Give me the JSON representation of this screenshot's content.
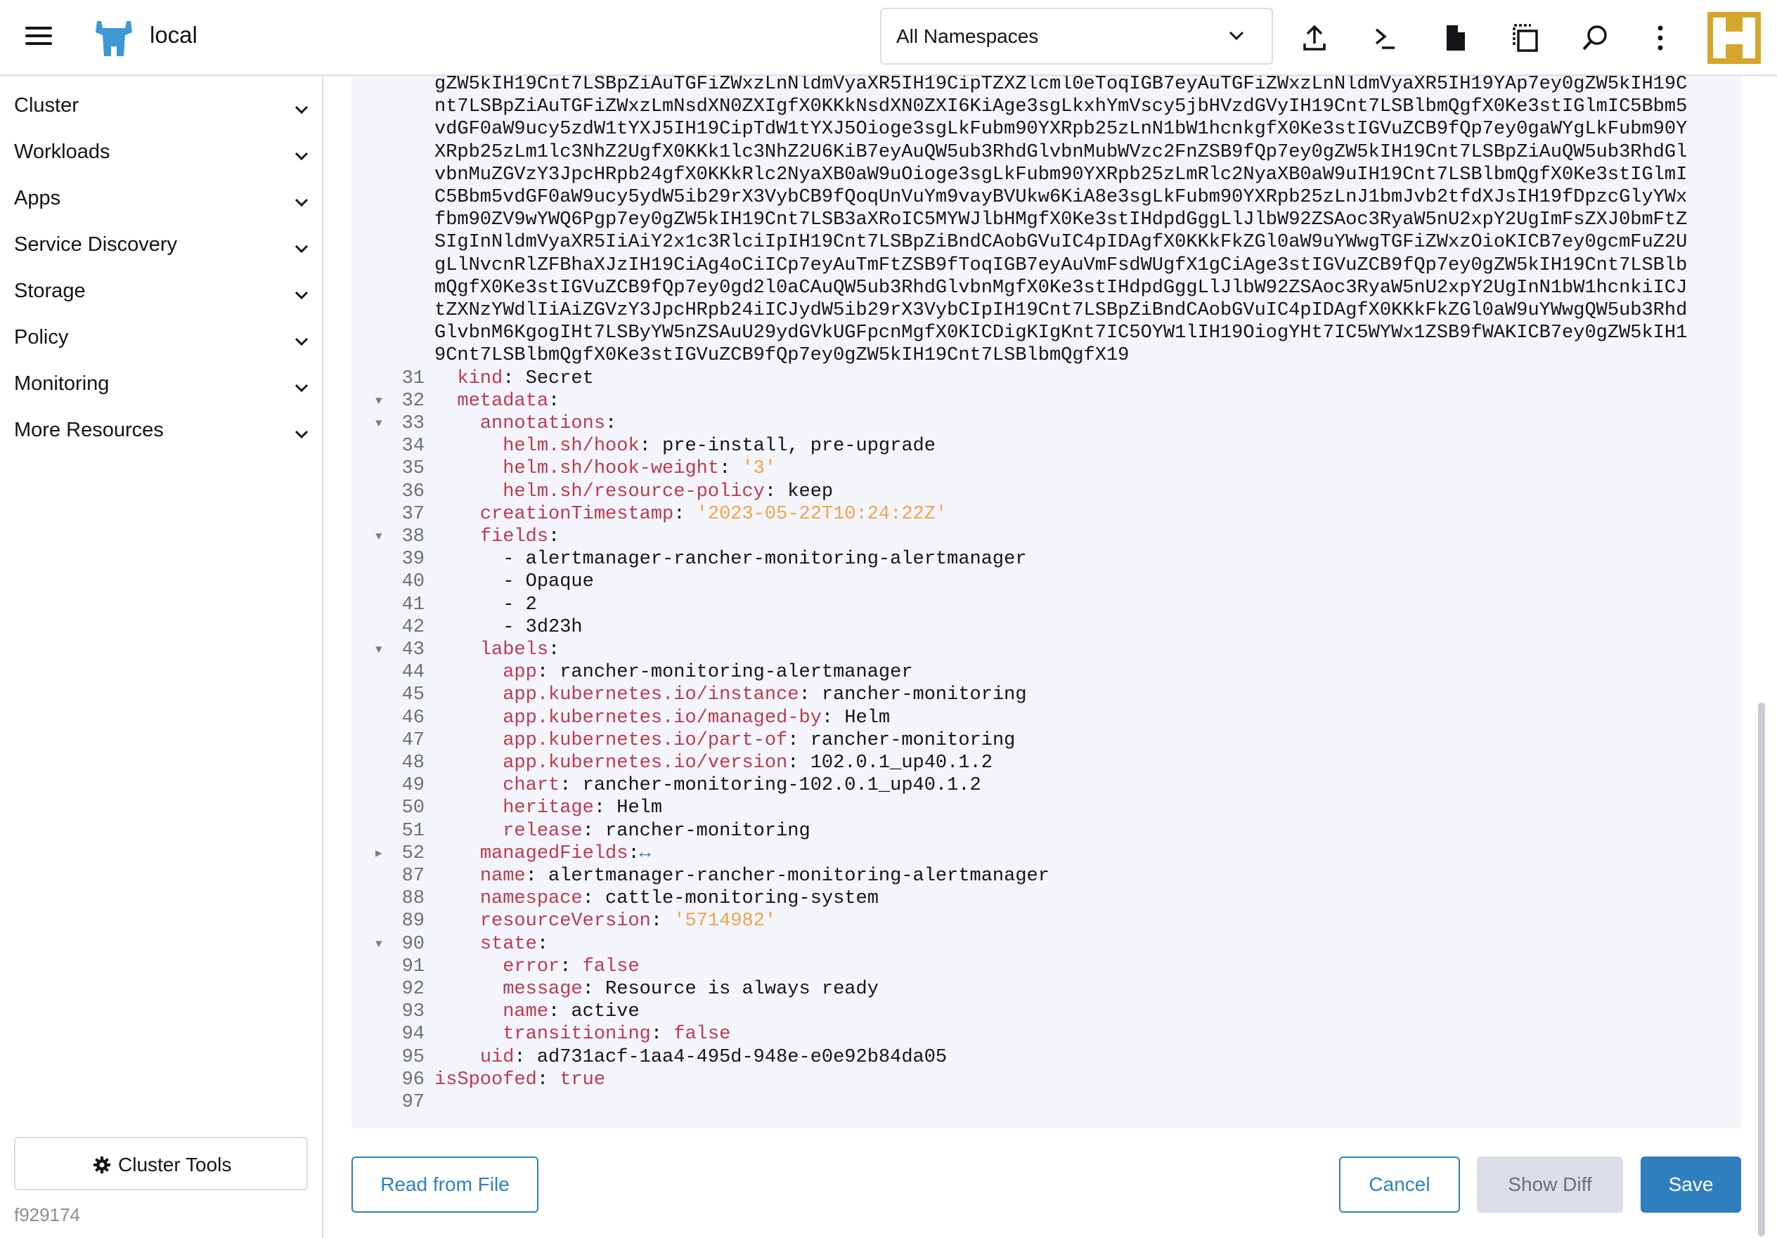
{
  "header": {
    "cluster_name": "local",
    "namespace_select": "All Namespaces",
    "icons": [
      "menu-icon",
      "cattle-logo-icon",
      "chevron-down-icon",
      "upload-icon",
      "terminal-icon",
      "file-icon",
      "copy-config-icon",
      "search-icon",
      "kebab-menu-icon",
      "brand-logo"
    ]
  },
  "sidebar": {
    "items": [
      {
        "label": "Cluster"
      },
      {
        "label": "Workloads"
      },
      {
        "label": "Apps"
      },
      {
        "label": "Service Discovery"
      },
      {
        "label": "Storage"
      },
      {
        "label": "Policy"
      },
      {
        "label": "Monitoring"
      },
      {
        "label": "More Resources"
      }
    ],
    "cluster_tools": "Cluster Tools",
    "version": "f929174"
  },
  "editor": {
    "b64_lines": [
      "gZW5kIH19Cnt7LSBpZiAuTGFiZWxzLnNldmVyaXR5IH19CipTZXZlcml0eToqIGB7eyAuTGFiZWxzLnNldmVyaXR5IH19YAp7ey0gZW5kIH19C",
      "nt7LSBpZiAuTGFiZWxzLmNsdXN0ZXIgfX0KKkNsdXN0ZXI6KiAge3sgLkxhYmVscy5jbHVzdGVyIH19Cnt7LSBlbmQgfX0Ke3stIGlmIC5Bbm5",
      "vdGF0aW9ucy5zdW1tYXJ5IH19CipTdW1tYXJ5Oioge3sgLkFubm90YXRpb25zLnN1bW1hcnkgfX0Ke3stIGVuZCB9fQp7ey0gaWYgLkFubm90Y",
      "XRpb25zLm1lc3NhZ2UgfX0KKk1lc3NhZ2U6KiB7eyAuQW5ub3RhdGlvbnMubWVzc2FnZSB9fQp7ey0gZW5kIH19Cnt7LSBpZiAuQW5ub3RhdGl",
      "vbnMuZGVzY3JpcHRpb24gfX0KKkRlc2NyaXB0aW9uOioge3sgLkFubm90YXRpb25zLmRlc2NyaXB0aW9uIH19Cnt7LSBlbmQgfX0Ke3stIGlmI",
      "C5Bbm5vdGF0aW9ucy5ydW5ib29rX3VybCB9fQoqUnVuYm9vayBVUkw6KiA8e3sgLkFubm90YXRpb25zLnJ1bmJvb2tfdXJsIH19fDpzcGlyYWx",
      "fbm90ZV9wYWQ6Pgp7ey0gZW5kIH19Cnt7LSB3aXRoIC5MYWJlbHMgfX0Ke3stIHdpdGggLlJlbW92ZSAoc3RyaW5nU2xpY2UgImFsZXJ0bmFtZ",
      "SIgInNldmVyaXR5IiAiY2x1c3RlciIpIH19Cnt7LSBpZiBndCAobGVuIC4pIDAgfX0KKkFkZGl0aW9uYWwgTGFiZWxzOioKICB7ey0gcmFuZ2U",
      "gLlNvcnRlZFBhaXJzIH19CiAg4oCiICp7eyAuTmFtZSB9fToqIGB7eyAuVmFsdWUgfX1gCiAge3stIGVuZCB9fQp7ey0gZW5kIH19Cnt7LSBlb",
      "mQgfX0Ke3stIGVuZCB9fQp7ey0gd2l0aCAuQW5ub3RhdGlvbnMgfX0Ke3stIHdpdGggLlJlbW92ZSAoc3RyaW5nU2xpY2UgInN1bW1hcnkiICJ",
      "tZXNzYWdlIiAiZGVzY3JpcHRpb24iICJydW5ib29rX3VybCIpIH19Cnt7LSBpZiBndCAobGVuIC4pIDAgfX0KKkFkZGl0aW9uYWwgQW5ub3Rhd",
      "GlvbnM6KgogIHt7LSByYW5nZSAuU29ydGVkUGFpcnMgfX0KICDigKIgKnt7IC5OYW1lIH19OiogYHt7IC5WYWx1ZSB9fWAKICB7ey0gZW5kIH1",
      "9Cnt7LSBlbmQgfX0Ke3stIGVuZCB9fQp7ey0gZW5kIH19Cnt7LSBlbmQgfX19"
    ],
    "lines": [
      {
        "n": "31",
        "indent": "  ",
        "key": "kind",
        "sep": ": ",
        "val": "Secret",
        "type": "plain"
      },
      {
        "n": "32",
        "fold": "▼",
        "indent": "  ",
        "key": "metadata",
        "sep": ":",
        "val": "",
        "type": "plain"
      },
      {
        "n": "33",
        "fold": "▼",
        "indent": "    ",
        "key": "annotations",
        "sep": ":",
        "val": "",
        "type": "plain"
      },
      {
        "n": "34",
        "indent": "      ",
        "key": "helm.sh/hook",
        "sep": ": ",
        "val": "pre-install, pre-upgrade",
        "type": "plain"
      },
      {
        "n": "35",
        "indent": "      ",
        "key": "helm.sh/hook-weight",
        "sep": ": ",
        "val": "'3'",
        "type": "string"
      },
      {
        "n": "36",
        "indent": "      ",
        "key": "helm.sh/resource-policy",
        "sep": ": ",
        "val": "keep",
        "type": "plain"
      },
      {
        "n": "37",
        "indent": "    ",
        "key": "creationTimestamp",
        "sep": ": ",
        "val": "'2023-05-22T10:24:22Z'",
        "type": "string"
      },
      {
        "n": "38",
        "fold": "▼",
        "indent": "    ",
        "key": "fields",
        "sep": ":",
        "val": "",
        "type": "plain"
      },
      {
        "n": "39",
        "indent": "      ",
        "key": "",
        "sep": "",
        "val": "- alertmanager-rancher-monitoring-alertmanager",
        "type": "plain"
      },
      {
        "n": "40",
        "indent": "      ",
        "key": "",
        "sep": "",
        "val": "- Opaque",
        "type": "plain"
      },
      {
        "n": "41",
        "indent": "      ",
        "key": "",
        "sep": "",
        "val": "- 2",
        "type": "plain"
      },
      {
        "n": "42",
        "indent": "      ",
        "key": "",
        "sep": "",
        "val": "- 3d23h",
        "type": "plain"
      },
      {
        "n": "43",
        "fold": "▼",
        "indent": "    ",
        "key": "labels",
        "sep": ":",
        "val": "",
        "type": "plain"
      },
      {
        "n": "44",
        "indent": "      ",
        "key": "app",
        "sep": ": ",
        "val": "rancher-monitoring-alertmanager",
        "type": "plain"
      },
      {
        "n": "45",
        "indent": "      ",
        "key": "app.kubernetes.io/instance",
        "sep": ": ",
        "val": "rancher-monitoring",
        "type": "plain"
      },
      {
        "n": "46",
        "indent": "      ",
        "key": "app.kubernetes.io/managed-by",
        "sep": ": ",
        "val": "Helm",
        "type": "plain"
      },
      {
        "n": "47",
        "indent": "      ",
        "key": "app.kubernetes.io/part-of",
        "sep": ": ",
        "val": "rancher-monitoring",
        "type": "plain"
      },
      {
        "n": "48",
        "indent": "      ",
        "key": "app.kubernetes.io/version",
        "sep": ": ",
        "val": "102.0.1_up40.1.2",
        "type": "plain"
      },
      {
        "n": "49",
        "indent": "      ",
        "key": "chart",
        "sep": ": ",
        "val": "rancher-monitoring-102.0.1_up40.1.2",
        "type": "plain"
      },
      {
        "n": "50",
        "indent": "      ",
        "key": "heritage",
        "sep": ": ",
        "val": "Helm",
        "type": "plain"
      },
      {
        "n": "51",
        "indent": "      ",
        "key": "release",
        "sep": ": ",
        "val": "rancher-monitoring",
        "type": "plain"
      },
      {
        "n": "52",
        "fold": "▶",
        "indent": "    ",
        "key": "managedFields",
        "sep": ":",
        "val": "↔",
        "type": "collapsed"
      },
      {
        "n": "87",
        "indent": "    ",
        "key": "name",
        "sep": ": ",
        "val": "alertmanager-rancher-monitoring-alertmanager",
        "type": "plain"
      },
      {
        "n": "88",
        "indent": "    ",
        "key": "namespace",
        "sep": ": ",
        "val": "cattle-monitoring-system",
        "type": "plain"
      },
      {
        "n": "89",
        "indent": "    ",
        "key": "resourceVersion",
        "sep": ": ",
        "val": "'5714982'",
        "type": "string"
      },
      {
        "n": "90",
        "fold": "▼",
        "indent": "    ",
        "key": "state",
        "sep": ":",
        "val": "",
        "type": "plain"
      },
      {
        "n": "91",
        "indent": "      ",
        "key": "error",
        "sep": ": ",
        "val": "false",
        "type": "bool"
      },
      {
        "n": "92",
        "indent": "      ",
        "key": "message",
        "sep": ": ",
        "val": "Resource is always ready",
        "type": "plain"
      },
      {
        "n": "93",
        "indent": "      ",
        "key": "name",
        "sep": ": ",
        "val": "active",
        "type": "plain"
      },
      {
        "n": "94",
        "indent": "      ",
        "key": "transitioning",
        "sep": ": ",
        "val": "false",
        "type": "bool"
      },
      {
        "n": "95",
        "indent": "    ",
        "key": "uid",
        "sep": ": ",
        "val": "ad731acf-1aa4-495d-948e-e0e92b84da05",
        "type": "plain"
      },
      {
        "n": "96",
        "indent": "",
        "key": "isSpoofed",
        "sep": ": ",
        "val": "true",
        "type": "bool"
      },
      {
        "n": "97",
        "indent": "",
        "key": "",
        "sep": "",
        "val": "",
        "type": "plain"
      }
    ]
  },
  "footer": {
    "read_from_file": "Read from File",
    "cancel": "Cancel",
    "show_diff": "Show Diff",
    "save": "Save"
  },
  "colors": {
    "accent": "#2f7fbf",
    "yaml_key": "#bd3a4f",
    "yaml_string": "#f2a24d",
    "brand": "#d4a72c"
  }
}
